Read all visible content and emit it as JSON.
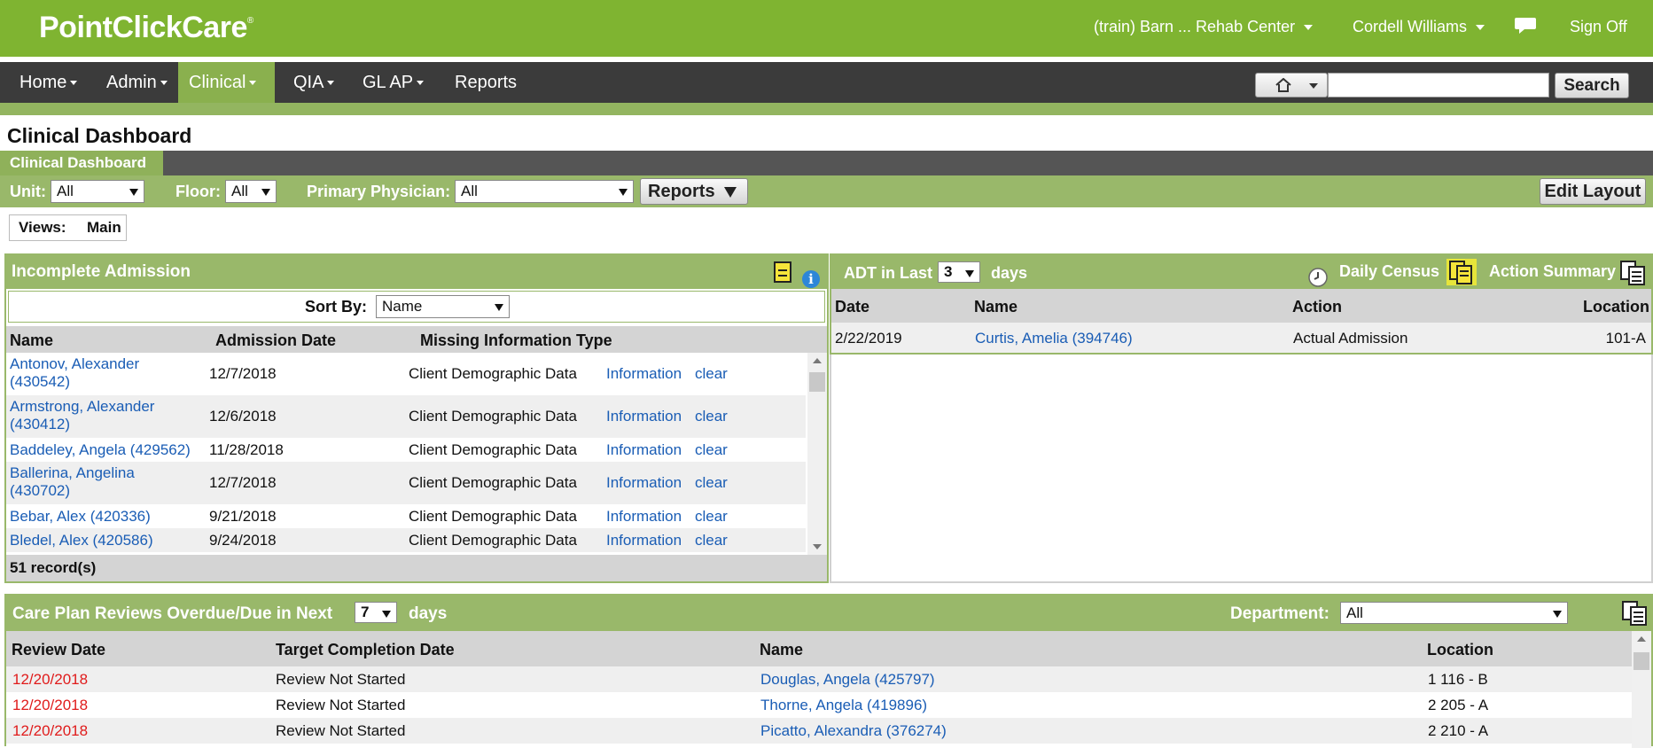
{
  "app": {
    "logo": "PointClickCare",
    "logo_mark": "®",
    "facility": "(train) Barn ... Rehab Center",
    "user": "Cordell Williams",
    "sign_off": "Sign Off"
  },
  "nav": {
    "items": [
      "Home",
      "Admin",
      "Clinical",
      "QIA",
      "GL AP",
      "Reports"
    ],
    "active": "Clinical",
    "search_value": "",
    "search_button": "Search"
  },
  "page": {
    "title": "Clinical Dashboard",
    "tab": "Clinical Dashboard"
  },
  "filters": {
    "unit_label": "Unit:",
    "unit_value": "All",
    "floor_label": "Floor:",
    "floor_value": "All",
    "physician_label": "Primary Physician:",
    "physician_value": "All",
    "reports_button": "Reports",
    "edit_layout_button": "Edit Layout"
  },
  "views": {
    "label": "Views:",
    "value": "Main"
  },
  "incomplete_admission": {
    "title": "Incomplete Admission",
    "sort_label": "Sort By:",
    "sort_value": "Name",
    "columns": [
      "Name",
      "Admission Date",
      "Missing Information Type"
    ],
    "rows": [
      {
        "name_line1": "Antonov, Alexander",
        "name_line2": "(430542)",
        "date": "12/7/2018",
        "type": "Client Demographic Data",
        "info": "Information",
        "clear": "clear"
      },
      {
        "name_line1": "Armstrong, Alexander",
        "name_line2": "(430412)",
        "date": "12/6/2018",
        "type": "Client Demographic Data",
        "info": "Information",
        "clear": "clear"
      },
      {
        "name_line1": "Baddeley, Angela (429562)",
        "name_line2": "",
        "date": "11/28/2018",
        "type": "Client Demographic Data",
        "info": "Information",
        "clear": "clear"
      },
      {
        "name_line1": "Ballerina, Angelina",
        "name_line2": "(430702)",
        "date": "12/7/2018",
        "type": "Client Demographic Data",
        "info": "Information",
        "clear": "clear"
      },
      {
        "name_line1": "Bebar, Alex (420336)",
        "name_line2": "",
        "date": "9/21/2018",
        "type": "Client Demographic Data",
        "info": "Information",
        "clear": "clear"
      },
      {
        "name_line1": "Bledel, Alex (420586)",
        "name_line2": "",
        "date": "9/24/2018",
        "type": "Client Demographic Data",
        "info": "Information",
        "clear": "clear"
      }
    ],
    "record_count": "51 record(s)"
  },
  "adt": {
    "title_prefix": "ADT in Last",
    "days_value": "3",
    "title_suffix": "days",
    "daily_census": "Daily Census",
    "action_summary": "Action Summary",
    "columns": [
      "Date",
      "Name",
      "Action",
      "Location"
    ],
    "rows": [
      {
        "date": "2/22/2019",
        "name": "Curtis, Amelia (394746)",
        "action": "Actual Admission",
        "location": "101-A"
      }
    ]
  },
  "care_plan": {
    "title_prefix": "Care Plan Reviews Overdue/Due in Next",
    "days_value": "7",
    "title_suffix": "days",
    "department_label": "Department:",
    "department_value": "All",
    "columns": [
      "Review Date",
      "Target Completion Date",
      "Name",
      "Location"
    ],
    "rows": [
      {
        "review_date": "12/20/2018",
        "target": "Review Not Started",
        "name": "Douglas, Angela (425797)",
        "location": "1 116 - B"
      },
      {
        "review_date": "12/20/2018",
        "target": "Review Not Started",
        "name": "Thorne, Angela (419896)",
        "location": "2 205 - A"
      },
      {
        "review_date": "12/20/2018",
        "target": "Review Not Started",
        "name": "Picatto, Alexandra (376274)",
        "location": "2 210 - A"
      }
    ]
  },
  "colors": {
    "brand_green": "#7fb431",
    "panel_green": "#99b86a",
    "nav_dark": "#3b3b3b",
    "link_blue": "#1a5db5",
    "overdue_red": "#e01b1b"
  }
}
